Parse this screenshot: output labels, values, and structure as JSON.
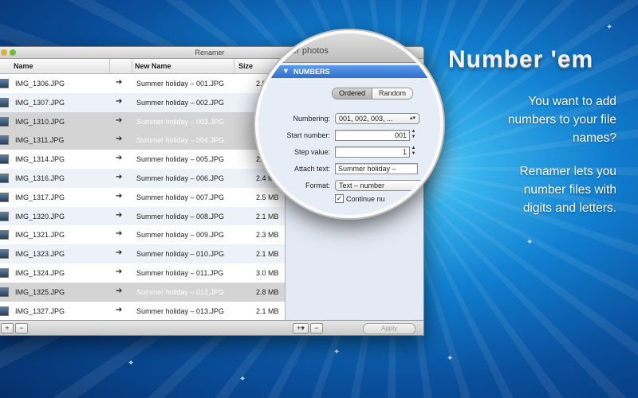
{
  "window": {
    "title": "Renamer",
    "columns": {
      "name": "Name",
      "new_name": "New Name",
      "size": "Size"
    },
    "rows": [
      {
        "name": "IMG_1306.JPG",
        "new": "Summer holiday – 001.JPG",
        "size": "2.8",
        "state": "normal"
      },
      {
        "name": "IMG_1307.JPG",
        "new": "Summer holiday – 002.JPG",
        "size": "",
        "state": "alt"
      },
      {
        "name": "IMG_1310.JPG",
        "new": "Summer holiday – 003.JPG",
        "size": "",
        "state": "selected"
      },
      {
        "name": "IMG_1311.JPG",
        "new": "Summer holiday – 004.JPG",
        "size": "",
        "state": "selected"
      },
      {
        "name": "IMG_1314.JPG",
        "new": "Summer holiday – 005.JPG",
        "size": "2.",
        "state": "normal"
      },
      {
        "name": "IMG_1316.JPG",
        "new": "Summer holiday – 006.JPG",
        "size": "2.4 M",
        "state": "alt"
      },
      {
        "name": "IMG_1317.JPG",
        "new": "Summer holiday – 007.JPG",
        "size": "2.5 MB",
        "state": "normal"
      },
      {
        "name": "IMG_1320.JPG",
        "new": "Summer holiday – 008.JPG",
        "size": "2.1 MB",
        "state": "alt"
      },
      {
        "name": "IMG_1321.JPG",
        "new": "Summer holiday – 009.JPG",
        "size": "2.3 MB",
        "state": "normal"
      },
      {
        "name": "IMG_1323.JPG",
        "new": "Summer holiday – 010.JPG",
        "size": "2.1 MB",
        "state": "alt"
      },
      {
        "name": "IMG_1324.JPG",
        "new": "Summer holiday – 011.JPG",
        "size": "3.0 MB",
        "state": "normal"
      },
      {
        "name": "IMG_1325.JPG",
        "new": "Summer holiday – 012.JPG",
        "size": "2.8 MB",
        "state": "selected"
      },
      {
        "name": "IMG_1327.JPG",
        "new": "Summer holiday – 013.JPG",
        "size": "2.1 MB",
        "state": "normal"
      }
    ],
    "bottom": {
      "add": "+",
      "remove": "−",
      "action_add": "+▾",
      "action_remove": "−",
      "apply": "Apply"
    }
  },
  "lens": {
    "panel_title": "er photos",
    "section": "NUMBERS",
    "segment": {
      "ordered": "Ordered",
      "random": "Random"
    },
    "labels": {
      "numbering": "Numbering:",
      "start": "Start number:",
      "step": "Step value:",
      "attach": "Attach text:",
      "format": "Format:"
    },
    "numbering_value": "001, 002, 003, ...",
    "start_value": "001",
    "step_value": "1",
    "attach_value": "Summer holiday –",
    "format_value": "Text – number",
    "continue_label": "Continue nu"
  },
  "marketing": {
    "headline": "Number 'em",
    "lines1": [
      "You want to add",
      "numbers to your file",
      "names?"
    ],
    "lines2": [
      "Renamer lets you",
      "number files with",
      "digits and letters."
    ]
  },
  "colors": {
    "selection": "#d4d4d4",
    "section_bar": "#3b7bd6",
    "background": "#117ecf"
  }
}
